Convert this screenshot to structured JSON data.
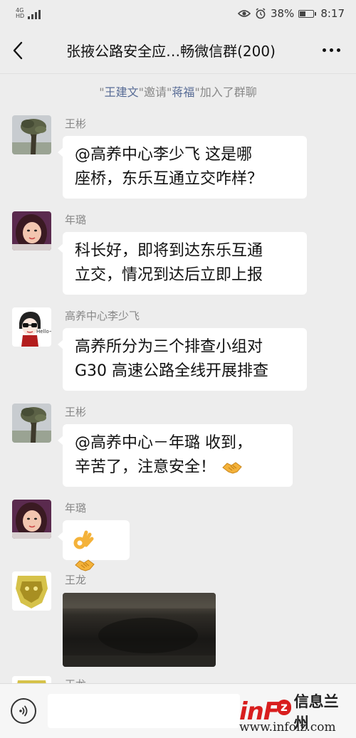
{
  "status_bar": {
    "network": "4G",
    "network_sub": "HD",
    "battery": "38%",
    "time": "8:17"
  },
  "header": {
    "title": "张掖公路安全应…畅微信群(200)"
  },
  "system_message": {
    "quote_open": "\"",
    "inviter": "王建文",
    "mid1": "\"邀请\"",
    "invitee": "蒋福",
    "mid2": "\"加入了群聊"
  },
  "messages": [
    {
      "sender": "王彬",
      "text_lines": [
        "@高养中心李少飞  这是哪",
        "座桥，东乐互通立交咋样？"
      ]
    },
    {
      "sender": "年璐",
      "text_lines": [
        "科长好，即将到达东乐互通",
        "立交，情况到达后立即上报"
      ]
    },
    {
      "sender": "高养中心李少飞",
      "text_lines": [
        "高养所分为三个排查小组对",
        "G30 高速公路全线开展排查"
      ]
    },
    {
      "sender": "王彬",
      "text_lines": [
        "@高养中心－年璐  收到，",
        "辛苦了，注意安全！"
      ]
    },
    {
      "sender": "年璐",
      "text_lines": []
    },
    {
      "sender": "王龙",
      "text_lines": []
    },
    {
      "sender": "王龙",
      "text_lines": []
    }
  ],
  "avatar_labels": {
    "hello": "Hello~"
  },
  "input_bar": {
    "placeholder": ""
  },
  "watermark": {
    "logo_in": "in",
    "logo_f": "F",
    "logo_z": "z",
    "logo_cn": "信息兰州",
    "url": "www.infolz.com"
  },
  "colors": {
    "background": "#ededed",
    "bubble": "#ffffff",
    "link_name": "#576b95",
    "watermark_red": "#d81e1e"
  },
  "icons": [
    "back-arrow-icon",
    "more-dots-icon",
    "voice-icon",
    "eye-icon",
    "alarm-icon",
    "battery-icon",
    "signal-icon"
  ]
}
